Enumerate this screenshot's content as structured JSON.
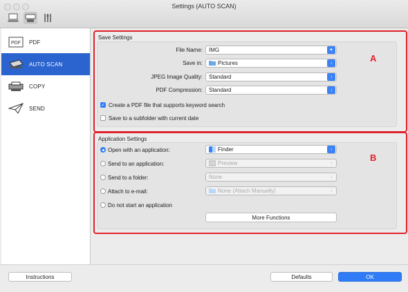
{
  "window": {
    "title": "Settings (AUTO SCAN)"
  },
  "toolbar": {
    "items": [
      {
        "name": "scan-from-computer",
        "selected": false
      },
      {
        "name": "scan-from-operation-panel",
        "selected": true
      },
      {
        "name": "general-settings",
        "selected": false
      }
    ]
  },
  "sidebar": {
    "items": [
      {
        "label": "PDF",
        "active": false
      },
      {
        "label": "AUTO SCAN",
        "active": true
      },
      {
        "label": "COPY",
        "active": false
      },
      {
        "label": "SEND",
        "active": false
      }
    ]
  },
  "save_settings": {
    "title": "Save Settings",
    "marker": "A",
    "file_name": {
      "label": "File Name:",
      "value": "IMG"
    },
    "save_in": {
      "label": "Save in:",
      "value": "Pictures"
    },
    "jpeg_quality": {
      "label": "JPEG Image Quality:",
      "value": "Standard"
    },
    "pdf_compression": {
      "label": "PDF Compression:",
      "value": "Standard"
    },
    "checkbox_keyword": {
      "label": "Create a PDF file that supports keyword search",
      "checked": true
    },
    "checkbox_subfolder": {
      "label": "Save to a subfolder with current date",
      "checked": false
    }
  },
  "application_settings": {
    "title": "Application Settings",
    "marker": "B",
    "options": [
      {
        "label": "Open with an application:",
        "value": "Finder",
        "selected": true,
        "enabled": true
      },
      {
        "label": "Send to an application:",
        "value": "Preview",
        "selected": false,
        "enabled": false
      },
      {
        "label": "Send to a folder:",
        "value": "None",
        "selected": false,
        "enabled": false
      },
      {
        "label": "Attach to e-mail:",
        "value": "None (Attach Manually)",
        "selected": false,
        "enabled": false
      },
      {
        "label": "Do not start an application",
        "selected": false
      }
    ],
    "more_functions": "More Functions"
  },
  "footer": {
    "instructions": "Instructions",
    "defaults": "Defaults",
    "ok": "OK"
  },
  "colors": {
    "accent": "#2f7cf6",
    "sidebar_active": "#2b63cf",
    "annotation": "#e0202a"
  }
}
